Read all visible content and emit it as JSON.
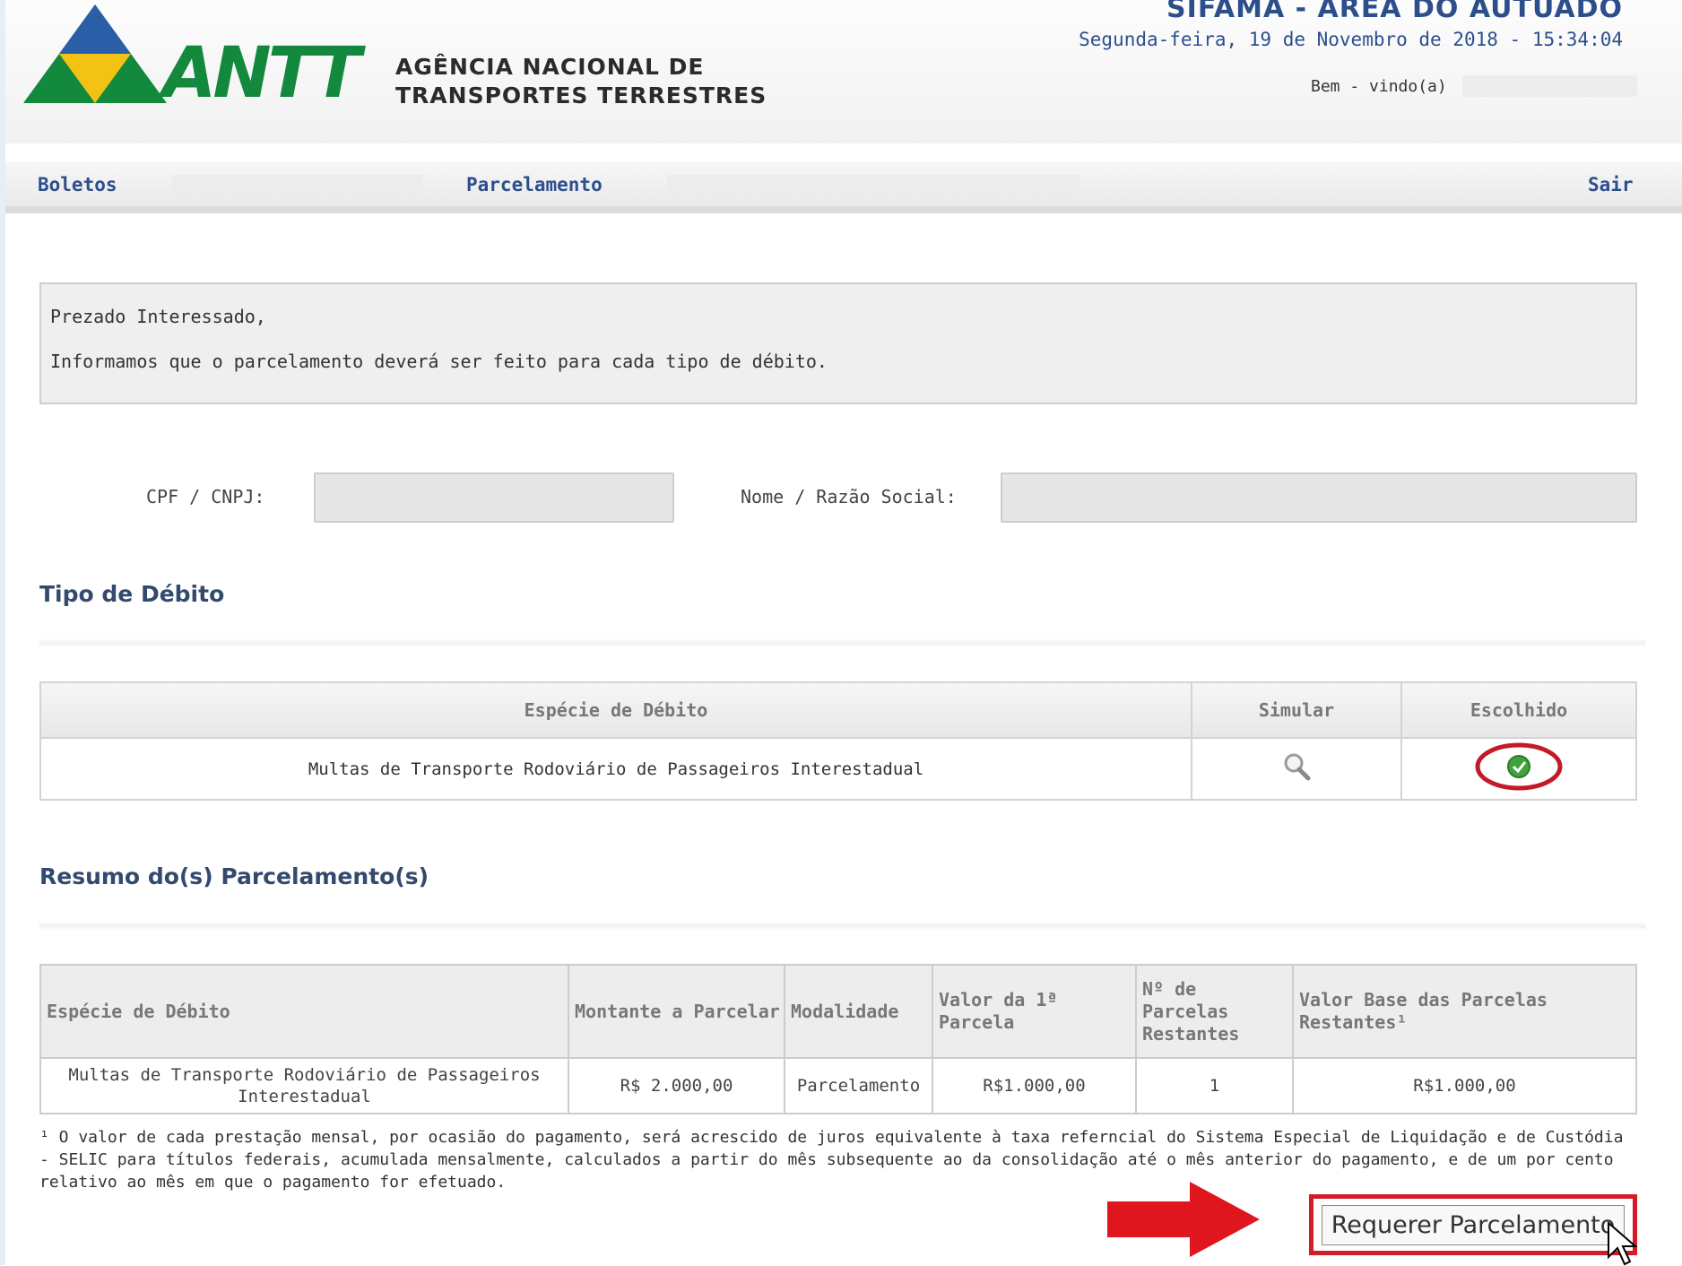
{
  "header": {
    "logo_text": "ANTT",
    "agency_line1": "AGÊNCIA NACIONAL DE",
    "agency_line2": "TRANSPORTES TERRESTRES",
    "system_title": "SIFAMA - ÁREA DO AUTUADO",
    "date_time": "Segunda-feira, 19 de Novembro de 2018 - 15:34:04",
    "welcome": "Bem - vindo(a)"
  },
  "nav": {
    "boletos": "Boletos",
    "parcelamento": "Parcelamento",
    "sair": "Sair"
  },
  "notice": {
    "line1": "Prezado Interessado,",
    "line2": "Informamos que o parcelamento deverá ser feito para cada tipo de débito."
  },
  "form": {
    "cpf_label": "CPF / CNPJ:",
    "nome_label": "Nome / Razão Social:"
  },
  "tipo_debito": {
    "title": "Tipo de Débito",
    "headers": [
      "Espécie de Débito",
      "Simular",
      "Escolhido"
    ],
    "row": {
      "especie": "Multas de Transporte Rodoviário de Passageiros Interestadual"
    }
  },
  "resumo": {
    "title": "Resumo do(s) Parcelamento(s)",
    "headers": [
      "Espécie de Débito",
      "Montante a Parcelar",
      "Modalidade",
      "Valor da 1ª Parcela",
      "Nº de Parcelas Restantes",
      "Valor Base das Parcelas Restantes¹"
    ],
    "row": [
      "Multas de Transporte Rodoviário de Passageiros Interestadual",
      "R$ 2.000,00",
      "Parcelamento",
      "R$1.000,00",
      "1",
      "R$1.000,00"
    ]
  },
  "footnote": "¹ O valor de cada prestação mensal, por ocasião do pagamento, será acrescido de juros equivalente à taxa referncial do Sistema Especial de Liquidação e de Custódia - SELIC para títulos federais, acumulada mensalmente, calculados a partir do mês subsequente ao da consolidação até o mês anterior do pagamento, e de um por cento relativo ao mês em que o pagamento for efetuado.",
  "button": {
    "requerer": "Requerer Parcelamento"
  },
  "colors": {
    "brand_green": "#12893c",
    "brand_blue": "#2c4f8c",
    "highlight_red": "#d21c2a"
  }
}
